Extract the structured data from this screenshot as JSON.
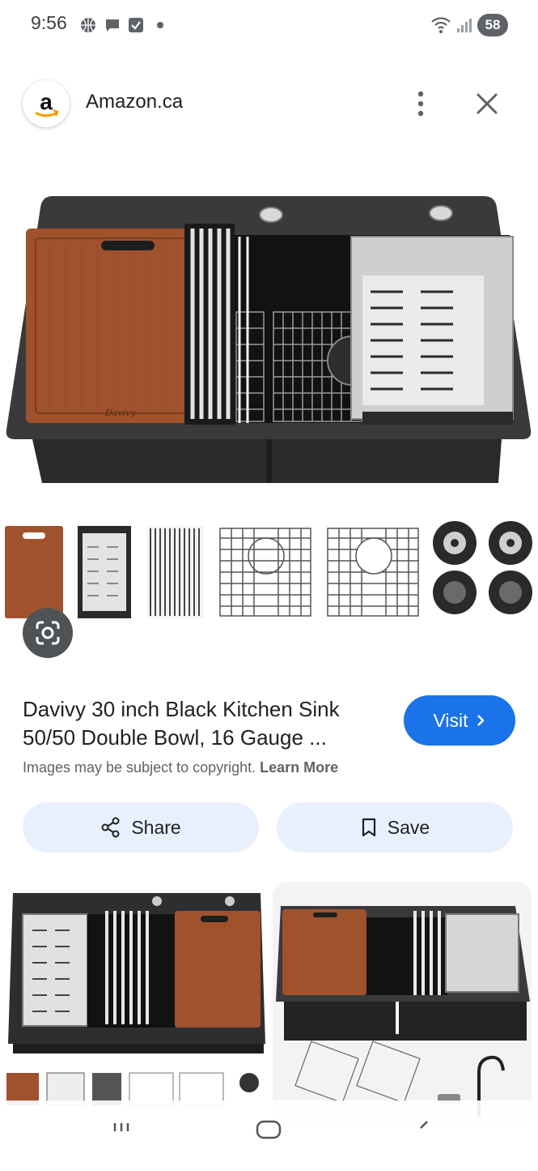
{
  "status_bar": {
    "time": "9:56",
    "battery": "58",
    "icons": [
      "basketball-icon",
      "chat-bubble-icon",
      "checkbox-icon",
      "dot-icon",
      "wifi-icon",
      "signal-icon"
    ]
  },
  "header": {
    "logo_letter": "a",
    "site_name": "Amazon.ca"
  },
  "product": {
    "title": "Davivy 30 inch Black Kitchen Sink 50/50 Double Bowl, 16 Gauge ...",
    "visit_label": "Visit",
    "copyright_text": "Images may be subject to copyright.",
    "learn_more": "Learn More",
    "share_label": "Share",
    "save_label": "Save",
    "board_brand": "Davivy"
  },
  "colors": {
    "accent": "#1a73e8",
    "pill": "#e8f0fe",
    "sink": "#2b2b2d",
    "wood": "#a0522d"
  }
}
